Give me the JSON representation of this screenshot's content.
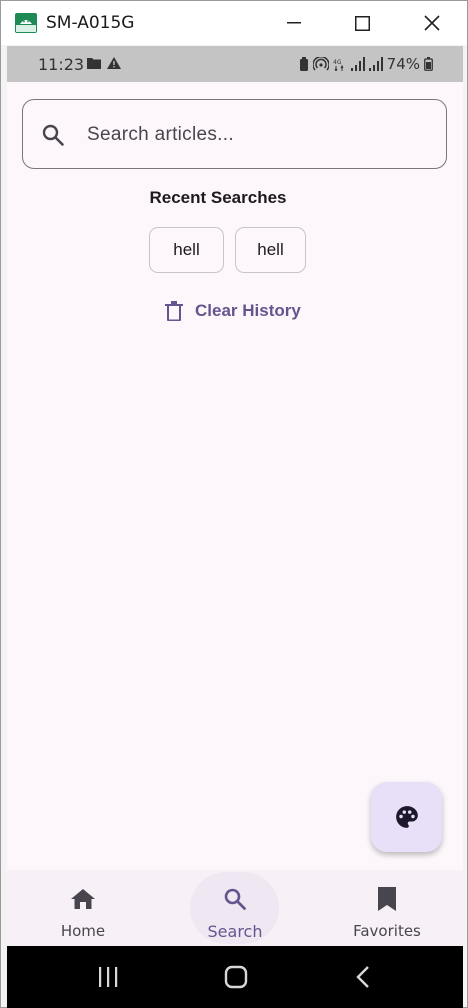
{
  "window": {
    "title": "SM-A015G"
  },
  "statusbar": {
    "time": "11:23",
    "battery": "74%"
  },
  "search": {
    "placeholder": "Search articles...",
    "value": ""
  },
  "recent": {
    "title": "Recent Searches",
    "chips": [
      "hell",
      "hell"
    ],
    "clear_label": "Clear History"
  },
  "fab": {
    "icon": "palette-icon"
  },
  "navbar": {
    "items": [
      {
        "label": "Home",
        "icon": "home-icon"
      },
      {
        "label": "Search",
        "icon": "search-icon"
      },
      {
        "label": "Favorites",
        "icon": "bookmark-icon"
      }
    ],
    "selected": "Search"
  },
  "colors": {
    "accent": "#65558f",
    "background": "#fdf7fb",
    "fab_bg": "#e8e0f8",
    "navbar_bg": "#f7f1f7"
  }
}
